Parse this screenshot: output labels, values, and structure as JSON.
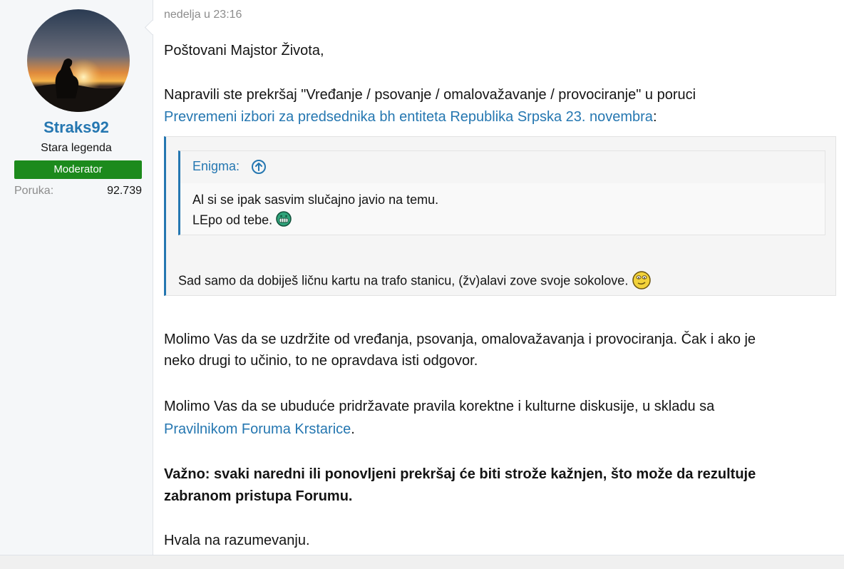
{
  "user": {
    "name": "Straks92",
    "title": "Stara legenda",
    "badge": "Moderator",
    "stat_label": "Poruka:",
    "stat_value": "92.739"
  },
  "post": {
    "date": "nedelja u 23:16",
    "greeting": "Poštovani Majstor Života,",
    "violation_text": "Napravili ste prekršaj \"Vređanje / psovanje / omalovažavanje / provociranje\" u poruci",
    "thread_link": "Prevremeni izbori za predsednika bh entiteta Republika Srpska 23. novembra",
    "colon": ":",
    "quote": {
      "inner_author": "Enigma:",
      "inner_line1": "Al si se ipak sasvim slučajno javio na temu.",
      "inner_line2": "LEpo od tebe.",
      "outer_text": "Sad samo da dobiješ ličnu kartu na trafo stanicu, (žv)alavi zove svoje sokolove."
    },
    "para1_line1": "Molimo Vas da se uzdržite od vređanja, psovanja, omalovažavanja i provociranja. Čak i ako je",
    "para1_line2": "neko drugi to učinio, to ne opravdava isti odgovor.",
    "para2_line1": "Molimo Vas da se ubuduće pridržavate pravila korektne i kulturne diskusije, u skladu sa",
    "para2_link": "Pravilnikom Foruma Krstarice",
    "para2_end": ".",
    "important_line1": "Važno: svaki naredni ili ponovljeni prekršaj će biti strože kažnjen, što može da rezultuje",
    "important_line2": "zabranom pristupa Forumu.",
    "thanks": "Hvala na razumevanju."
  },
  "icons": {
    "quote_up": "arrow-up-circle-icon",
    "smiley_grin": "grin-smiley-icon",
    "smiley_wink": "smug-smiley-icon"
  },
  "colors": {
    "link": "#2577b1",
    "badge": "#1c8a1c",
    "sidebar": "#f5f7f9"
  }
}
